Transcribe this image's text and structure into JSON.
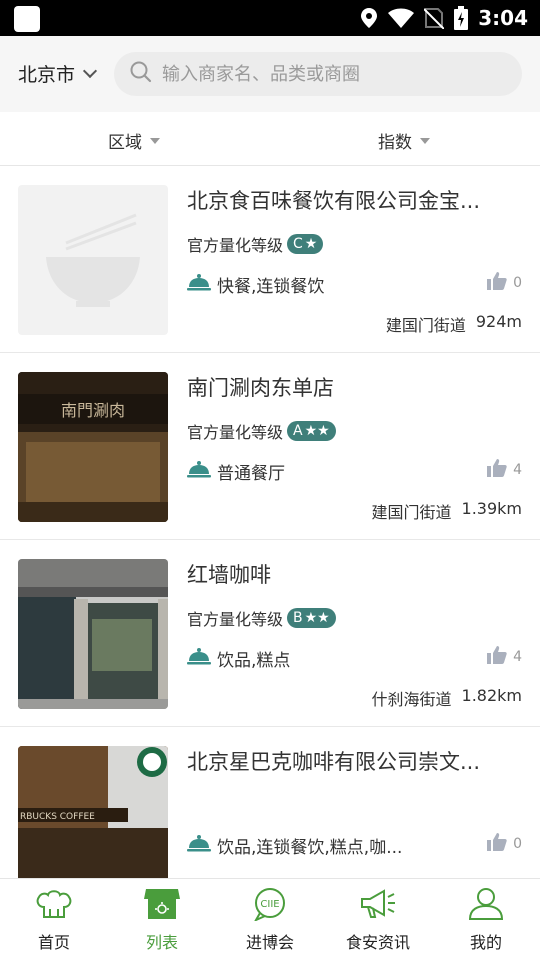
{
  "status_bar": {
    "time": "3:04"
  },
  "header": {
    "city": "北京市",
    "search_placeholder": "输入商家名、品类或商圈"
  },
  "filters": [
    {
      "label": "区域"
    },
    {
      "label": "指数"
    }
  ],
  "items": [
    {
      "name": "北京食百味餐饮有限公司金宝...",
      "grade_label": "官方量化等级",
      "grade": "C",
      "stars": "★",
      "category": "快餐,连锁餐饮",
      "likes": "0",
      "street": "建国门街道",
      "distance": "924m",
      "image": "placeholder-bowl"
    },
    {
      "name": "南门涮肉东单店",
      "grade_label": "官方量化等级",
      "grade": "A",
      "stars": "★★",
      "category": "普通餐厅",
      "likes": "4",
      "street": "建国门街道",
      "distance": "1.39km",
      "image": "dark-restaurant-sign",
      "sign_text": "南門涮肉"
    },
    {
      "name": "红墙咖啡",
      "grade_label": "官方量化等级",
      "grade": "B",
      "stars": "★★",
      "category": "饮品,糕点",
      "likes": "4",
      "street": "什刹海街道",
      "distance": "1.82km",
      "image": "storefront-windows"
    },
    {
      "name": "北京星巴克咖啡有限公司崇文...",
      "grade_label": "",
      "grade": "",
      "stars": "",
      "category": "饮品,连锁餐饮,糕点,咖...",
      "likes": "0",
      "street": "",
      "distance": "",
      "image": "starbucks-storefront",
      "sign_text": "RBUCKS COFFEE"
    }
  ],
  "bottom_nav": [
    {
      "label": "首页",
      "icon": "chef-hat-icon",
      "active": false
    },
    {
      "label": "列表",
      "icon": "store-icon",
      "active": true
    },
    {
      "label": "进博会",
      "icon": "ciie-chat-icon",
      "active": false
    },
    {
      "label": "食安资讯",
      "icon": "megaphone-icon",
      "active": false
    },
    {
      "label": "我的",
      "icon": "user-icon",
      "active": false
    }
  ],
  "colors": {
    "accent_green": "#4a9d3c",
    "badge_teal": "#3f7f7a",
    "icon_teal": "#3a8f8a"
  }
}
